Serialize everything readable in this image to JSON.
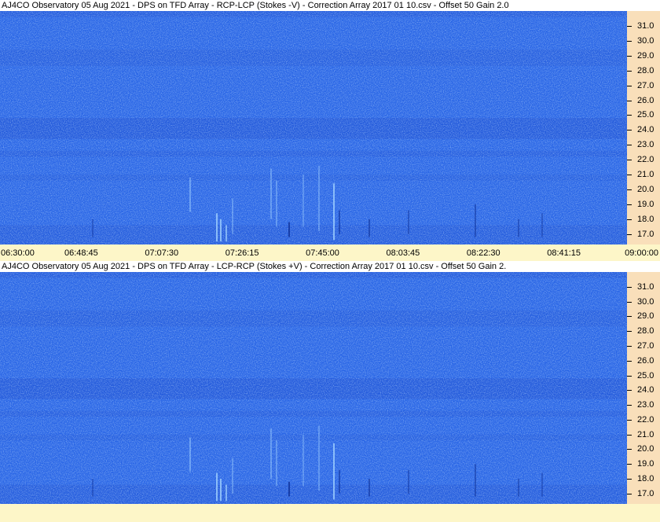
{
  "chart_data": [
    {
      "type": "heatmap",
      "title": "AJ4CO Observatory 05 Aug 2021  -  DPS on TFD Array  -  RCP-LCP (Stokes -V)  -  Correction Array 2017 01 10.csv  -  Offset 50  Gain 2.0",
      "x_ticks": [
        "06:30:00",
        "06:48:45",
        "07:07:30",
        "07:26:15",
        "07:45:00",
        "08:03:45",
        "08:22:30",
        "08:41:15",
        "09:00:00"
      ],
      "xlim": [
        "06:30:00",
        "09:00:00"
      ],
      "y_ticks": [
        "31.0",
        "30.0",
        "29.0",
        "28.0",
        "27.0",
        "26.0",
        "25.0",
        "24.0",
        "23.0",
        "22.0",
        "21.0",
        "20.0",
        "19.0",
        "18.0",
        "17.0"
      ],
      "ylim": [
        16.3,
        32.0
      ],
      "colors": {
        "background": "#2a66e6",
        "dark_band": "#1a48c8",
        "bright": "#9fd0ff"
      }
    },
    {
      "type": "heatmap",
      "title": "AJ4CO Observatory 05 Aug 2021  -  DPS on TFD Array  -  LCP-RCP (Stokes +V)  -  Correction Array 2017 01 10.csv  -  Offset 50  Gain 2.",
      "x_ticks": [],
      "y_ticks": [
        "31.0",
        "30.0",
        "29.0",
        "28.0",
        "27.0",
        "26.0",
        "25.0",
        "24.0",
        "23.0",
        "22.0",
        "21.0",
        "20.0",
        "19.0",
        "18.0",
        "17.0"
      ],
      "ylim": [
        16.3,
        32.0
      ],
      "colors": {
        "background": "#2a66e6",
        "dark_band": "#1a48c8",
        "bright": "#9fd0ff"
      }
    }
  ]
}
